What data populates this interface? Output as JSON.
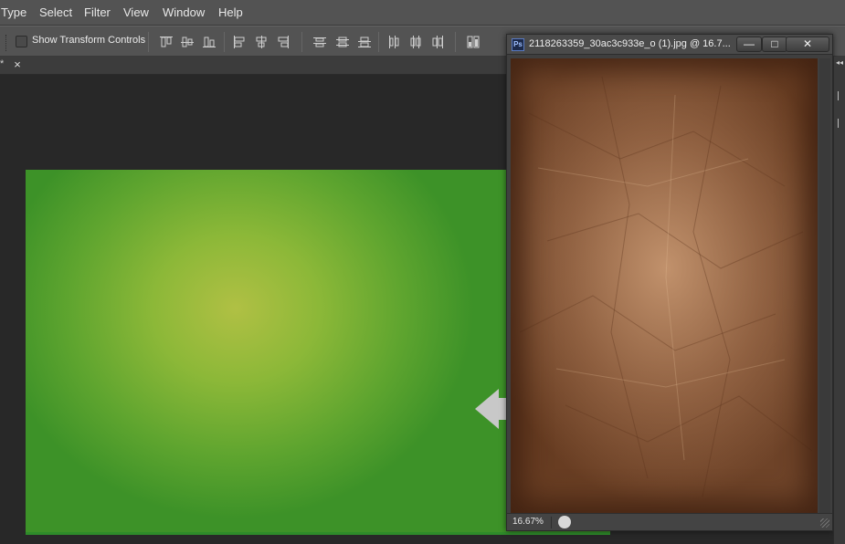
{
  "menubar": {
    "items": [
      "Type",
      "Select",
      "Filter",
      "View",
      "Window",
      "Help"
    ]
  },
  "options": {
    "show_transform_label": "Show Transform Controls",
    "show_transform_checked": false,
    "align_icons": [
      "align-top-edges-icon",
      "align-vertical-centers-icon",
      "align-bottom-edges-icon",
      "align-left-edges-icon",
      "align-horizontal-centers-icon",
      "align-right-edges-icon",
      "distribute-top-edges-icon",
      "distribute-vertical-centers-icon",
      "distribute-bottom-edges-icon",
      "distribute-left-edges-icon",
      "distribute-horizontal-centers-icon",
      "distribute-right-edges-icon",
      "auto-align-layers-icon"
    ]
  },
  "tab": {
    "modified_mark": "*",
    "close_glyph": "×"
  },
  "canvas": {
    "gradient_center_color": "#b0c044",
    "gradient_edge_color": "#3d9228"
  },
  "arrow": {
    "direction": "left",
    "color": "#c8c8c8"
  },
  "document_window": {
    "title": "2118263359_30ac3c933e_o (1).jpg @ 16.7...",
    "app_icon": "Ps",
    "minimize_glyph": "—",
    "maximize_glyph": "□",
    "close_glyph": "✕",
    "zoom": "16.67%",
    "image_colors": [
      "#6b3e22",
      "#c69670"
    ]
  },
  "right_panel": {
    "collapse_glyph": "◂◂"
  }
}
